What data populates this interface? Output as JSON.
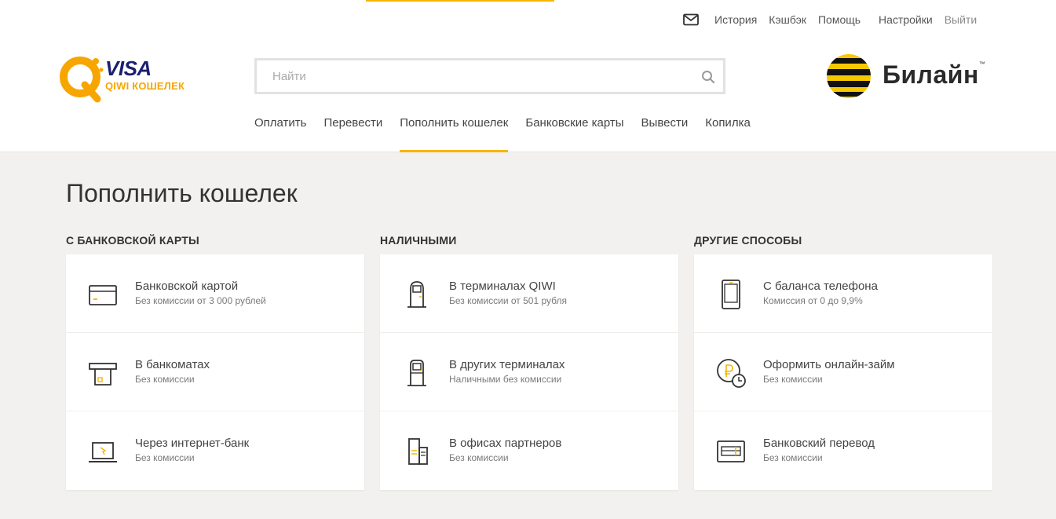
{
  "brand": {
    "logo_visa": "VISA",
    "logo_qiwi": "QIWI КОШЕЛЕК",
    "partner": "Билайн",
    "partner_tm": "™",
    "accent": "#f7b500"
  },
  "top_links": {
    "mail_icon": "envelope-icon",
    "history": "История",
    "cashback": "Кэшбэк",
    "help": "Помощь",
    "settings": "Настройки",
    "logout": "Выйти"
  },
  "search": {
    "placeholder": "Найти",
    "value": "",
    "icon": "search-icon"
  },
  "nav": {
    "pay": "Оплатить",
    "transfer": "Перевести",
    "topup": "Пополнить кошелек",
    "cards": "Банковские карты",
    "withdraw": "Вывести",
    "piggybank": "Копилка",
    "active": "Пополнить кошелек"
  },
  "page": {
    "title": "Пополнить кошелек"
  },
  "columns": [
    {
      "title": "С БАНКОВСКОЙ КАРТЫ",
      "items": [
        {
          "title": "Банковской картой",
          "sub": "Без комиссии от 3 000 рублей",
          "icon": "credit-card-icon"
        },
        {
          "title": "В банкоматах",
          "sub": "Без комиссии",
          "icon": "atm-icon"
        },
        {
          "title": "Через интернет-банк",
          "sub": "Без комиссии",
          "icon": "laptop-icon"
        }
      ]
    },
    {
      "title": "НАЛИЧНЫМИ",
      "items": [
        {
          "title": "В терминалах QIWI",
          "sub": "Без комиссии от 501 рубля",
          "icon": "qiwi-terminal-icon"
        },
        {
          "title": "В других терминалах",
          "sub": "Наличными без комиссии",
          "icon": "terminal-icon"
        },
        {
          "title": "В офисах партнеров",
          "sub": "Без комиссии",
          "icon": "office-icon"
        }
      ]
    },
    {
      "title": "ДРУГИЕ СПОСОБЫ",
      "items": [
        {
          "title": "С баланса телефона",
          "sub": "Комиссия от 0 до 9,9%",
          "icon": "phone-icon"
        },
        {
          "title": "Оформить онлайн-займ",
          "sub": "Без комиссии",
          "icon": "loan-icon"
        },
        {
          "title": "Банковский перевод",
          "sub": "Без комиссии",
          "icon": "bank-transfer-icon"
        }
      ]
    }
  ]
}
